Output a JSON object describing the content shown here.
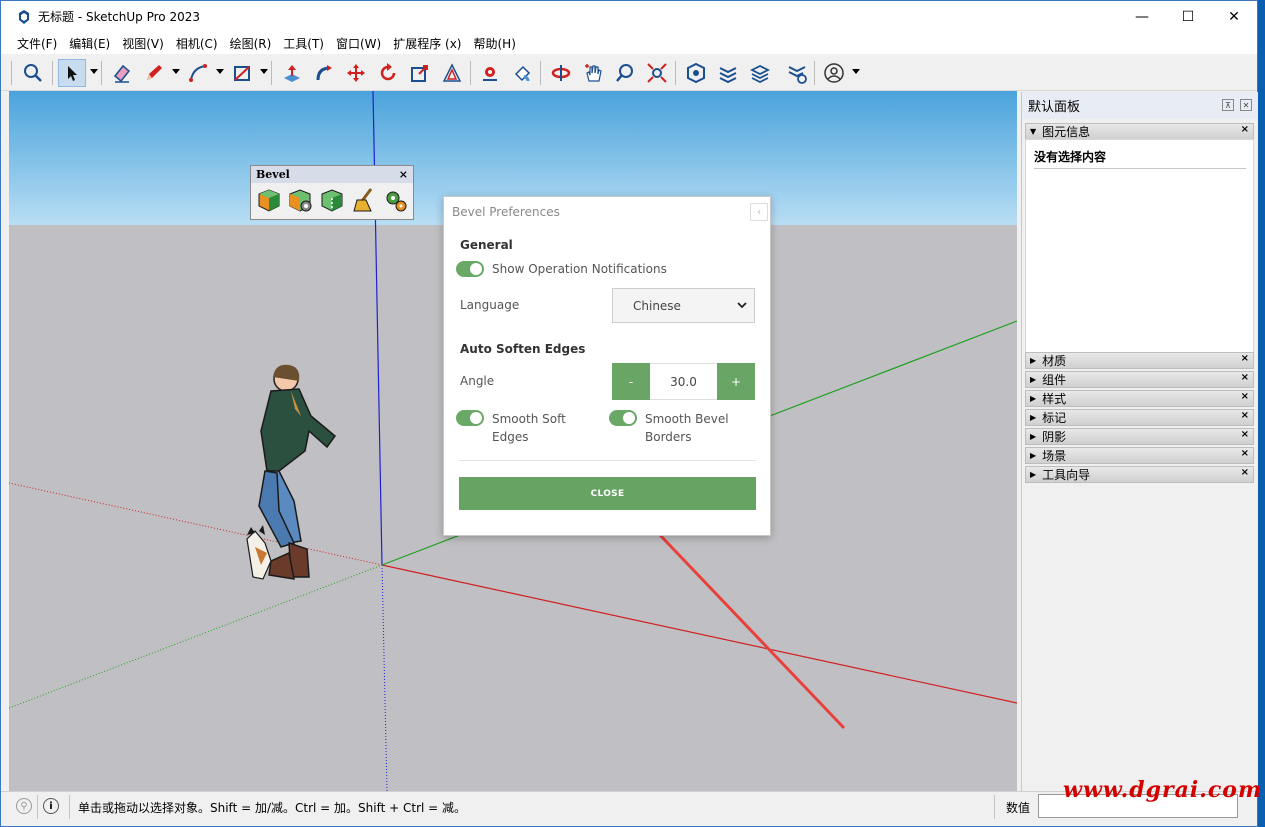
{
  "window": {
    "title": "无标题 - SketchUp Pro 2023",
    "minimize": "—",
    "maximize": "☐",
    "close": "✕"
  },
  "menu": [
    "文件(F)",
    "编辑(E)",
    "视图(V)",
    "相机(C)",
    "绘图(R)",
    "工具(T)",
    "窗口(W)",
    "扩展程序 (x)",
    "帮助(H)"
  ],
  "toolbar_icons": [
    "search-icon",
    "select-icon",
    "eraser-icon",
    "pencil-icon",
    "arc-icon",
    "rectangle-icon",
    "push-pull-icon",
    "follow-me-icon",
    "move-icon",
    "rotate-icon",
    "scale-icon",
    "offset-icon",
    "tape-measure-icon",
    "paint-bucket-icon",
    "orbit-icon",
    "pan-icon",
    "zoom-icon",
    "zoom-extents-icon",
    "warehouse-icon",
    "extension-warehouse-icon",
    "layout-icon",
    "extension-manager-icon",
    "account-icon"
  ],
  "bevel_toolbar": {
    "title": "Bevel",
    "close": "×",
    "icons": [
      "bevel-icon",
      "bevel-settings-icon",
      "bevel-soften-icon",
      "bevel-cleanup-icon",
      "preferences-gear-icon"
    ]
  },
  "dialog": {
    "title": "Bevel Preferences",
    "close_glyph": "‹",
    "general_title": "General",
    "show_notifications": "Show Operation Notifications",
    "show_notifications_on": true,
    "language_label": "Language",
    "language_value": "Chinese",
    "auto_soften_title": "Auto Soften Edges",
    "angle_label": "Angle",
    "angle_minus": "-",
    "angle_value": "30.0",
    "angle_plus": "+",
    "smooth_soft_line1": "Smooth Soft",
    "smooth_soft_line2": "Edges",
    "smooth_soft_on": true,
    "smooth_bevel_line1": "Smooth Bevel",
    "smooth_bevel_line2": "Borders",
    "smooth_bevel_on": true,
    "close_button": "CLOSE"
  },
  "tray": {
    "title": "默认面板",
    "entity_info": "图元信息",
    "no_selection": "没有选择内容",
    "panels": [
      "材质",
      "组件",
      "样式",
      "标记",
      "阴影",
      "场景",
      "工具向导"
    ]
  },
  "status": {
    "hint": "单击或拖动以选择对象。Shift = 加/减。Ctrl = 加。Shift + Ctrl = 减。",
    "measurements_label": "数值",
    "measurements_value": ""
  },
  "colors": {
    "accent_green": "#67a362",
    "axis_red": "#d02020",
    "axis_green": "#20a020",
    "axis_blue": "#2020d0",
    "arrow_red": "#e8403c",
    "watermark": "#d40000"
  },
  "watermark": "www.dgrai.com"
}
